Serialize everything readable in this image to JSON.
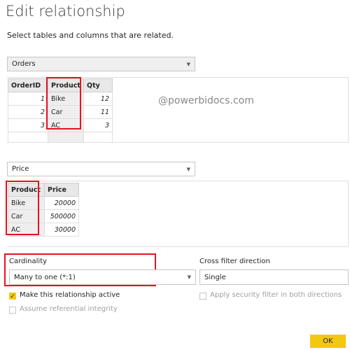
{
  "dialog": {
    "title": "Edit relationship",
    "subtitle": "Select tables and columns that are related."
  },
  "table1": {
    "selected": "Orders",
    "headers": [
      "OrderID",
      "Product",
      "Qty"
    ],
    "rows": [
      [
        "1",
        "Bike",
        "12"
      ],
      [
        "2",
        "Car",
        "11"
      ],
      [
        "3",
        "AC",
        "3"
      ]
    ]
  },
  "table2": {
    "selected": "Price",
    "headers": [
      "Product",
      "Price"
    ],
    "rows": [
      [
        "Bike",
        "20000"
      ],
      [
        "Car",
        "500000"
      ],
      [
        "AC",
        "30000"
      ]
    ]
  },
  "watermark": "@powerbidocs.com",
  "cardinality": {
    "label": "Cardinality",
    "value": "Many to one (*:1)"
  },
  "cross_filter": {
    "label": "Cross filter direction",
    "value": "Single"
  },
  "options": {
    "active_label": "Make this relationship active",
    "active_checked": true,
    "integrity_label": "Assume referential integrity",
    "integrity_checked": false,
    "security_label": "Apply security filter in both directions",
    "security_checked": false
  },
  "buttons": {
    "ok_label": "OK"
  },
  "colors": {
    "accent": "#f2c811",
    "highlight": "#e81123"
  },
  "icons": {
    "dropdown": "chevron-down-icon",
    "checkmark": "checkmark-icon"
  }
}
